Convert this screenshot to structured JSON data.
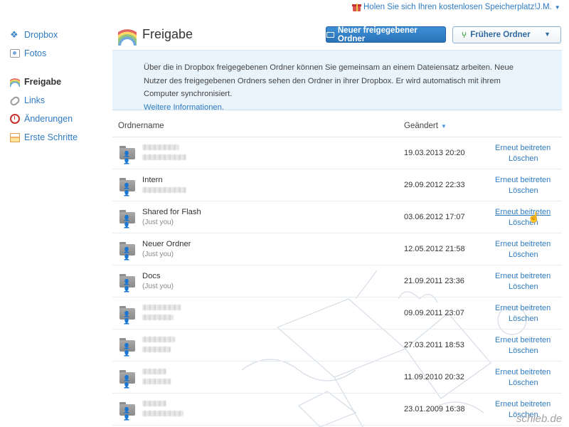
{
  "topbar": {
    "promo": "Holen Sie sich Ihren kostenlosen Speicherplatz!",
    "user": "J.M."
  },
  "sidebar": {
    "items": [
      {
        "label": "Dropbox"
      },
      {
        "label": "Fotos"
      },
      {
        "label": "Freigabe"
      },
      {
        "label": "Links"
      },
      {
        "label": "Änderungen"
      },
      {
        "label": "Erste Schritte"
      }
    ]
  },
  "header": {
    "title": "Freigabe",
    "primary_button": "Neuer freigegebener Ordner",
    "secondary_button": "Frühere Ordner"
  },
  "info": {
    "text": "Über die in Dropbox freigegebenen Ordner können Sie gemeinsam an einem Dateiensatz arbeiten. Neue Nutzer des freigegebenen Ordners sehen den Ordner in ihrer Dropbox. Er wird automatisch mit ihrem Computer synchronisiert.",
    "link": "Weitere Informationen."
  },
  "table": {
    "col_name": "Ordnername",
    "col_changed": "Geändert",
    "rows": [
      {
        "name": "",
        "sub": "",
        "date": "19.03.2013 20:20",
        "rejoin": "Erneut beitreten",
        "delete": "Löschen"
      },
      {
        "name": "Intern",
        "sub": "",
        "date": "29.09.2012 22:33",
        "rejoin": "Erneut beitreten",
        "delete": "Löschen"
      },
      {
        "name": "Shared for Flash",
        "sub": "(Just you)",
        "date": "03.06.2012 17:07",
        "rejoin": "Erneut beitreten",
        "delete": "Löschen"
      },
      {
        "name": "Neuer Ordner",
        "sub": "(Just you)",
        "date": "12.05.2012 21:58",
        "rejoin": "Erneut beitreten",
        "delete": "Löschen"
      },
      {
        "name": "Docs",
        "sub": "(Just you)",
        "date": "21.09.2011 23:36",
        "rejoin": "Erneut beitreten",
        "delete": "Löschen"
      },
      {
        "name": "",
        "sub": "",
        "date": "09.09.2011 23:07",
        "rejoin": "Erneut beitreten",
        "delete": "Löschen"
      },
      {
        "name": "",
        "sub": "",
        "date": "27.03.2011 18:53",
        "rejoin": "Erneut beitreten",
        "delete": "Löschen"
      },
      {
        "name": "",
        "sub": "",
        "date": "11.09.2010 20:32",
        "rejoin": "Erneut beitreten",
        "delete": "Löschen"
      },
      {
        "name": "",
        "sub": "",
        "date": "23.01.2009 16:38",
        "rejoin": "Erneut beitreten",
        "delete": "Löschen"
      }
    ]
  },
  "watermark": "schieb.de"
}
